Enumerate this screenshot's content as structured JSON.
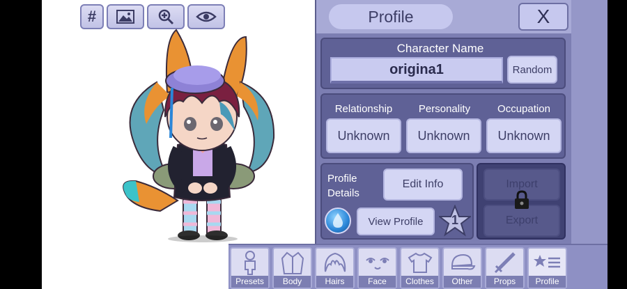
{
  "toolbar": {
    "grid_label": "#",
    "items": [
      "grid-button",
      "background-button",
      "zoom-button",
      "view-button"
    ]
  },
  "panel": {
    "title": "Profile",
    "close_label": "X",
    "character_name_label": "Character Name",
    "character_name_value": "origina1",
    "random_label": "Random",
    "relationship_label": "Relationship",
    "personality_label": "Personality",
    "occupation_label": "Occupation",
    "relationship_value": "Unknown",
    "personality_value": "Unknown",
    "occupation_value": "Unknown",
    "profile_details_label": "Profile\nDetails",
    "edit_info_label": "Edit Info",
    "view_profile_label": "View Profile",
    "level_badge": "1",
    "import_label": "Import",
    "export_label": "Export"
  },
  "tabs": [
    {
      "label": "Presets",
      "icon": "person-icon"
    },
    {
      "label": "Body",
      "icon": "jacket-icon"
    },
    {
      "label": "Hairs",
      "icon": "hair-icon"
    },
    {
      "label": "Face",
      "icon": "face-icon"
    },
    {
      "label": "Clothes",
      "icon": "shirt-icon"
    },
    {
      "label": "Other",
      "icon": "cap-icon"
    },
    {
      "label": "Props",
      "icon": "sword-icon"
    },
    {
      "label": "Profile",
      "icon": "star-list-icon",
      "active": true
    }
  ],
  "colors": {
    "panel": "#7c7eb2",
    "section": "#5f6196",
    "button": "#d4d6f4",
    "accent_blue": "#2a86d8"
  }
}
